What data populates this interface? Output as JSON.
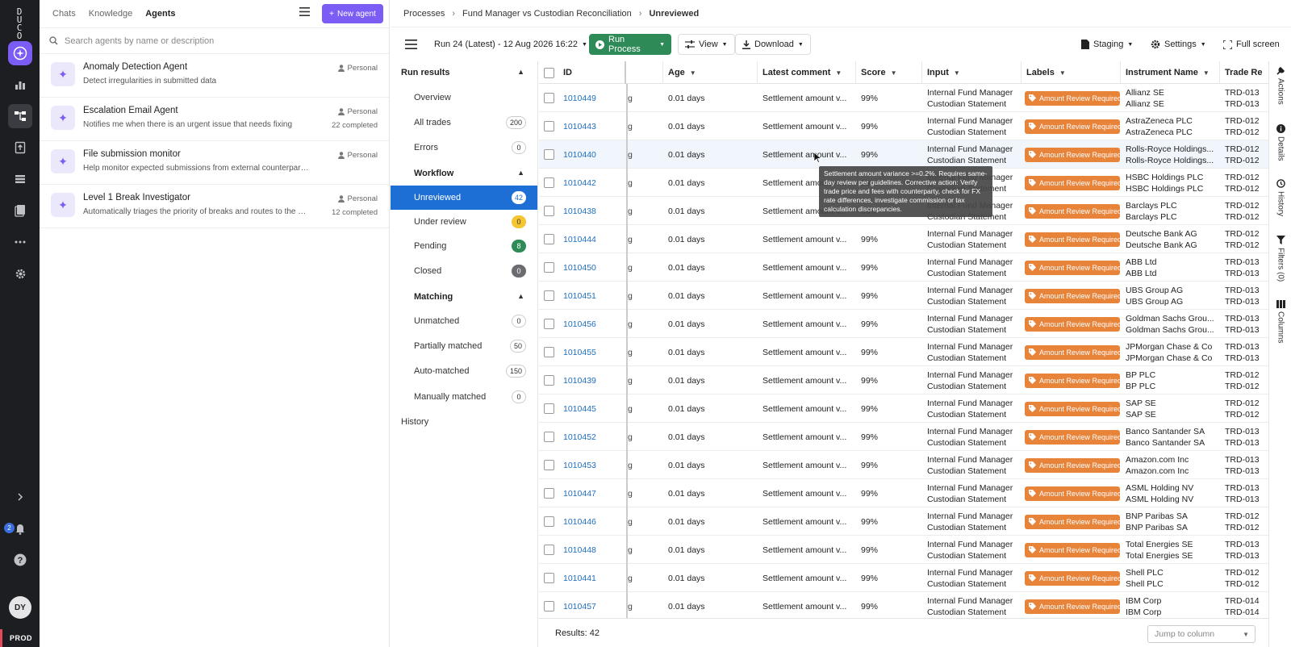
{
  "app": {
    "logo": "DUCO",
    "env": "PROD",
    "user_initials": "DY",
    "notifications": "2"
  },
  "agents_panel": {
    "tabs": [
      "Chats",
      "Knowledge",
      "Agents"
    ],
    "new_agent_label": "New agent",
    "search_placeholder": "Search agents by name or description",
    "agents": [
      {
        "name": "Anomaly Detection Agent",
        "desc": "Detect irregularities in submitted data",
        "tag": "Personal",
        "count": ""
      },
      {
        "name": "Escalation Email Agent",
        "desc": "Notifies me when there is an urgent issue that needs fixing",
        "tag": "Personal",
        "count": "22 completed"
      },
      {
        "name": "File submission monitor",
        "desc": "Help monitor expected submissions from external counterparties",
        "tag": "Personal",
        "count": ""
      },
      {
        "name": "Level 1 Break Investigator",
        "desc": "Automatically triages the priority of breaks and routes to the cor...",
        "tag": "Personal",
        "count": "12 completed"
      }
    ]
  },
  "breadcrumb": {
    "items": [
      "Processes",
      "Fund Manager vs Custodian Reconciliation",
      "Unreviewed"
    ]
  },
  "toolbar": {
    "run_select": "Run 24 (Latest) - 12 Aug 2026 16:22",
    "run_process": "Run Process",
    "view": "View",
    "download": "Download",
    "staging": "Staging",
    "settings": "Settings",
    "fullscreen": "Full screen"
  },
  "sidebar": {
    "run_results": "Run results",
    "overview": "Overview",
    "all_trades": {
      "label": "All trades",
      "count": "200"
    },
    "errors": {
      "label": "Errors",
      "count": "0"
    },
    "workflow": "Workflow",
    "workflow_items": [
      {
        "label": "Unreviewed",
        "count": "42"
      },
      {
        "label": "Under review",
        "count": "0"
      },
      {
        "label": "Pending",
        "count": "8"
      },
      {
        "label": "Closed",
        "count": "0"
      }
    ],
    "matching": "Matching",
    "matching_items": [
      {
        "label": "Unmatched",
        "count": "0"
      },
      {
        "label": "Partially matched",
        "count": "50"
      },
      {
        "label": "Auto-matched",
        "count": "150"
      },
      {
        "label": "Manually matched",
        "count": "0"
      }
    ],
    "history": "History"
  },
  "table": {
    "columns": [
      "ID",
      "Age",
      "Latest comment",
      "Score",
      "Input",
      "Labels",
      "Instrument Name",
      "Trade Re"
    ],
    "rows": [
      {
        "id": "1010449",
        "age": "0.01 days",
        "comment": "Settlement amount v...",
        "score": "99%",
        "input1": "Internal Fund Manager",
        "input2": "Custodian Statement",
        "label": "Amount Review Required",
        "inst1": "Allianz SE",
        "inst2": "Allianz SE",
        "tr1": "TRD-013",
        "tr2": "TRD-013"
      },
      {
        "id": "1010443",
        "age": "0.01 days",
        "comment": "Settlement amount v...",
        "score": "99%",
        "input1": "Internal Fund Manager",
        "input2": "Custodian Statement",
        "label": "Amount Review Required",
        "inst1": "AstraZeneca PLC",
        "inst2": "AstraZeneca PLC",
        "tr1": "TRD-012",
        "tr2": "TRD-012"
      },
      {
        "id": "1010440",
        "age": "0.01 days",
        "comment": "Settlement amount v...",
        "score": "99%",
        "input1": "Internal Fund Manager",
        "input2": "Custodian Statement",
        "label": "Amount Review Required",
        "inst1": "Rolls-Royce Holdings...",
        "inst2": "Rolls-Royce Holdings...",
        "tr1": "TRD-012",
        "tr2": "TRD-012"
      },
      {
        "id": "1010442",
        "age": "0.01 days",
        "comment": "Settlement amount v...",
        "score": "99%",
        "input1": "Internal Fund Manager",
        "input2": "Custodian Statement",
        "label": "Amount Review Required",
        "inst1": "HSBC Holdings PLC",
        "inst2": "HSBC Holdings PLC",
        "tr1": "TRD-012",
        "tr2": "TRD-012"
      },
      {
        "id": "1010438",
        "age": "0.01 days",
        "comment": "Settlement amount v...",
        "score": "99%",
        "input1": "Internal Fund Manager",
        "input2": "Custodian Statement",
        "label": "Amount Review Required",
        "inst1": "Barclays PLC",
        "inst2": "Barclays PLC",
        "tr1": "TRD-012",
        "tr2": "TRD-012"
      },
      {
        "id": "1010444",
        "age": "0.01 days",
        "comment": "Settlement amount v...",
        "score": "99%",
        "input1": "Internal Fund Manager",
        "input2": "Custodian Statement",
        "label": "Amount Review Required",
        "inst1": "Deutsche Bank AG",
        "inst2": "Deutsche Bank AG",
        "tr1": "TRD-012",
        "tr2": "TRD-012"
      },
      {
        "id": "1010450",
        "age": "0.01 days",
        "comment": "Settlement amount v...",
        "score": "99%",
        "input1": "Internal Fund Manager",
        "input2": "Custodian Statement",
        "label": "Amount Review Required",
        "inst1": "ABB Ltd",
        "inst2": "ABB Ltd",
        "tr1": "TRD-013",
        "tr2": "TRD-013"
      },
      {
        "id": "1010451",
        "age": "0.01 days",
        "comment": "Settlement amount v...",
        "score": "99%",
        "input1": "Internal Fund Manager",
        "input2": "Custodian Statement",
        "label": "Amount Review Required",
        "inst1": "UBS Group AG",
        "inst2": "UBS Group AG",
        "tr1": "TRD-013",
        "tr2": "TRD-013"
      },
      {
        "id": "1010456",
        "age": "0.01 days",
        "comment": "Settlement amount v...",
        "score": "99%",
        "input1": "Internal Fund Manager",
        "input2": "Custodian Statement",
        "label": "Amount Review Required",
        "inst1": "Goldman Sachs Grou...",
        "inst2": "Goldman Sachs Grou...",
        "tr1": "TRD-013",
        "tr2": "TRD-013"
      },
      {
        "id": "1010455",
        "age": "0.01 days",
        "comment": "Settlement amount v...",
        "score": "99%",
        "input1": "Internal Fund Manager",
        "input2": "Custodian Statement",
        "label": "Amount Review Required",
        "inst1": "JPMorgan Chase & Co",
        "inst2": "JPMorgan Chase & Co",
        "tr1": "TRD-013",
        "tr2": "TRD-013"
      },
      {
        "id": "1010439",
        "age": "0.01 days",
        "comment": "Settlement amount v...",
        "score": "99%",
        "input1": "Internal Fund Manager",
        "input2": "Custodian Statement",
        "label": "Amount Review Required",
        "inst1": "BP PLC",
        "inst2": "BP PLC",
        "tr1": "TRD-012",
        "tr2": "TRD-012"
      },
      {
        "id": "1010445",
        "age": "0.01 days",
        "comment": "Settlement amount v...",
        "score": "99%",
        "input1": "Internal Fund Manager",
        "input2": "Custodian Statement",
        "label": "Amount Review Required",
        "inst1": "SAP SE",
        "inst2": "SAP SE",
        "tr1": "TRD-012",
        "tr2": "TRD-012"
      },
      {
        "id": "1010452",
        "age": "0.01 days",
        "comment": "Settlement amount v...",
        "score": "99%",
        "input1": "Internal Fund Manager",
        "input2": "Custodian Statement",
        "label": "Amount Review Required",
        "inst1": "Banco Santander SA",
        "inst2": "Banco Santander SA",
        "tr1": "TRD-013",
        "tr2": "TRD-013"
      },
      {
        "id": "1010453",
        "age": "0.01 days",
        "comment": "Settlement amount v...",
        "score": "99%",
        "input1": "Internal Fund Manager",
        "input2": "Custodian Statement",
        "label": "Amount Review Required",
        "inst1": "Amazon.com Inc",
        "inst2": "Amazon.com Inc",
        "tr1": "TRD-013",
        "tr2": "TRD-013"
      },
      {
        "id": "1010447",
        "age": "0.01 days",
        "comment": "Settlement amount v...",
        "score": "99%",
        "input1": "Internal Fund Manager",
        "input2": "Custodian Statement",
        "label": "Amount Review Required",
        "inst1": "ASML Holding NV",
        "inst2": "ASML Holding NV",
        "tr1": "TRD-013",
        "tr2": "TRD-013"
      },
      {
        "id": "1010446",
        "age": "0.01 days",
        "comment": "Settlement amount v...",
        "score": "99%",
        "input1": "Internal Fund Manager",
        "input2": "Custodian Statement",
        "label": "Amount Review Required",
        "inst1": "BNP Paribas SA",
        "inst2": "BNP Paribas SA",
        "tr1": "TRD-012",
        "tr2": "TRD-012"
      },
      {
        "id": "1010448",
        "age": "0.01 days",
        "comment": "Settlement amount v...",
        "score": "99%",
        "input1": "Internal Fund Manager",
        "input2": "Custodian Statement",
        "label": "Amount Review Required",
        "inst1": "Total Energies SE",
        "inst2": "Total Energies SE",
        "tr1": "TRD-013",
        "tr2": "TRD-013"
      },
      {
        "id": "1010441",
        "age": "0.01 days",
        "comment": "Settlement amount v...",
        "score": "99%",
        "input1": "Internal Fund Manager",
        "input2": "Custodian Statement",
        "label": "Amount Review Required",
        "inst1": "Shell PLC",
        "inst2": "Shell PLC",
        "tr1": "TRD-012",
        "tr2": "TRD-012"
      },
      {
        "id": "1010457",
        "age": "0.01 days",
        "comment": "Settlement amount v...",
        "score": "99%",
        "input1": "Internal Fund Manager",
        "input2": "Custodian Statement",
        "label": "Amount Review Required",
        "inst1": "IBM Corp",
        "inst2": "IBM Corp",
        "tr1": "TRD-014",
        "tr2": "TRD-014"
      }
    ]
  },
  "tooltip": "Settlement amount variance >=0.2%. Requires same-day review per guidelines. Corrective action: Verify trade price and fees with counterparty, check for FX rate differences, investigate commission or tax calculation discrepancies.",
  "footer": {
    "results": "Results: 42",
    "jump_placeholder": "Jump to column"
  },
  "right_rail": [
    "Actions",
    "Details",
    "History",
    "Filters (0)",
    "Columns"
  ],
  "colors": {
    "accent": "#7b5cf5",
    "selected": "#1d6fd6",
    "run_button": "#2e8b57",
    "label": "#e8833a",
    "rail": "#1d1e22"
  }
}
